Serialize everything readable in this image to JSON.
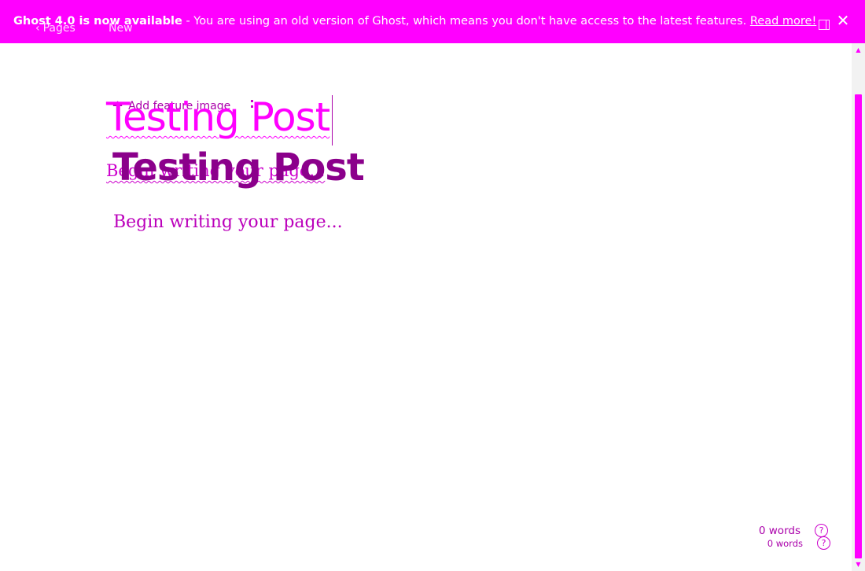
{
  "banner": {
    "headline": "Ghost 4.0 is now available",
    "separator": " - ",
    "message": "You are using an old version of Ghost, which means you don't have access to the latest features. ",
    "link": "Read more!",
    "close_glyph": "✕"
  },
  "nav": {
    "back_chevron": "‹",
    "back_label": "Pages",
    "status_label": "New"
  },
  "editor": {
    "add_feature_image": "Add feature image",
    "add_feature_image_icon": "plus-icon",
    "title_value": "Testing Post",
    "body_placeholder": "Begin writing your page..."
  },
  "footer": {
    "word_count": "0 words",
    "word_count_secondary": "0 words",
    "help_glyph": "?"
  },
  "scrollbar": {
    "up_glyph": "▲",
    "down_glyph": "▼"
  },
  "colors": {
    "accent": "#ff00ff",
    "title": "#8b008b",
    "text": "#aa00aa"
  }
}
